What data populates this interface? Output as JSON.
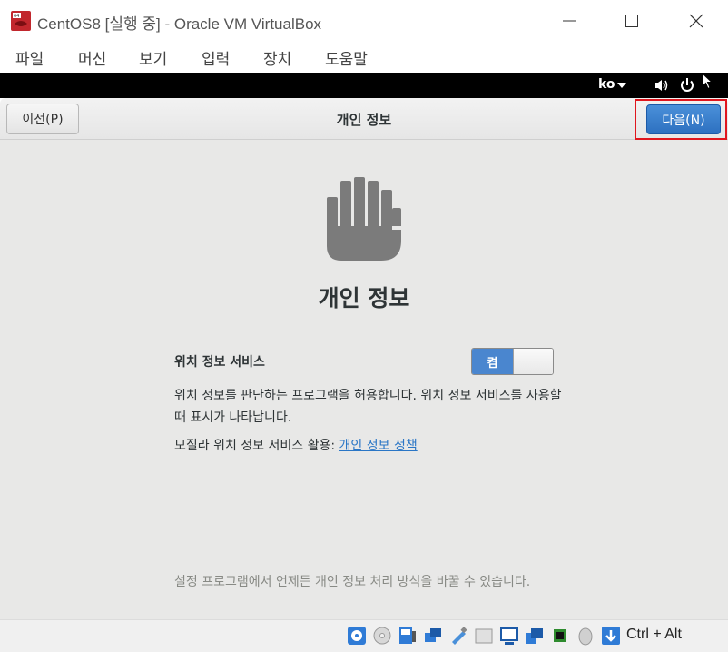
{
  "window": {
    "title": "CentOS8 [실행 중] - Oracle VM VirtualBox"
  },
  "menu": {
    "items": [
      "파일",
      "머신",
      "보기",
      "입력",
      "장치",
      "도움말"
    ]
  },
  "guest_topbar": {
    "language": "ko"
  },
  "header": {
    "prev_label": "이전(P)",
    "title": "개인 정보",
    "next_label": "다음(N)"
  },
  "content": {
    "heading": "개인 정보",
    "location_label": "위치 정보 서비스",
    "toggle_on_label": "켬",
    "toggle_state": "on",
    "description": "위치 정보를 판단하는 프로그램을 허용합니다. 위치 정보 서비스를 사용할 때 표시가 나타납니다.",
    "policy_prefix": "모질라 위치 정보 서비스 활용: ",
    "policy_link": "개인 정보 정책",
    "footer_note": "설정 프로그램에서 언제든 개인 정보 처리 방식을 바꿀 수 있습니다."
  },
  "statusbar": {
    "host_key": "Ctrl + Alt",
    "icons": [
      "hard-disk-icon",
      "optical-drive-icon",
      "audio-icon",
      "network-icon",
      "usb-icon",
      "shared-folder-icon",
      "display-icon",
      "video-capture-icon",
      "cpu-icon",
      "mouse-integration-icon",
      "host-key-arrow-icon"
    ]
  },
  "colors": {
    "accent": "#2d70c0",
    "highlight": "#e0161e",
    "link": "#2a76c6",
    "guest_background": "#e8e8e7"
  }
}
